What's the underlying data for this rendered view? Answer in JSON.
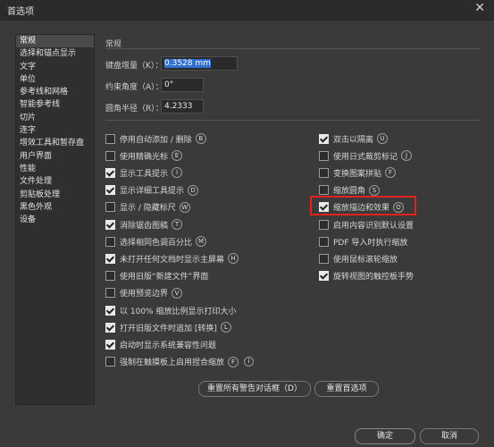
{
  "window": {
    "title": "首选项",
    "close": "✕"
  },
  "sidebar": {
    "items": [
      {
        "label": "常规",
        "selected": true
      },
      {
        "label": "选择和锚点显示"
      },
      {
        "label": "文字"
      },
      {
        "label": "单位"
      },
      {
        "label": "参考线和网格"
      },
      {
        "label": "智能参考线"
      },
      {
        "label": "切片"
      },
      {
        "label": "连字"
      },
      {
        "label": "增效工具和暂存盘"
      },
      {
        "label": "用户界面"
      },
      {
        "label": "性能"
      },
      {
        "label": "文件处理"
      },
      {
        "label": "剪贴板处理"
      },
      {
        "label": "黑色外观"
      },
      {
        "label": "设备"
      }
    ]
  },
  "section_title": "常规",
  "fields": {
    "keyboard_increment": {
      "label": "键盘增量（K）：",
      "value": "0.3528 mm"
    },
    "constrain_angle": {
      "label": "约束角度（A）：",
      "value": "0°"
    },
    "corner_radius": {
      "label": "圆角半径（R）：",
      "value": "4.2333"
    }
  },
  "checkboxes_left": [
    {
      "label": "停用自动添加 / 删除",
      "key": "B",
      "checked": false
    },
    {
      "label": "使用精确光标",
      "key": "E",
      "checked": false
    },
    {
      "label": "显示工具提示",
      "key": "I",
      "checked": true
    },
    {
      "label": "显示详细工具提示",
      "key": "D",
      "checked": true
    },
    {
      "label": "显示 / 隐藏标尺",
      "key": "W",
      "checked": false
    },
    {
      "label": "消除锯齿图稿",
      "key": "T",
      "checked": true
    },
    {
      "label": "选择相同色调百分比",
      "key": "M",
      "checked": false
    },
    {
      "label": "未打开任何文档时显示主屏幕",
      "key": "H",
      "checked": true
    },
    {
      "label": "使用旧版“新建文件”界面",
      "key": "",
      "checked": false
    },
    {
      "label": "使用预览边界",
      "key": "V",
      "checked": false
    },
    {
      "label": "以 100% 缩放比例显示打印大小",
      "key": "",
      "checked": true
    },
    {
      "label": "打开旧版文件时追加 [转换]",
      "key": "L",
      "checked": true
    },
    {
      "label": "启动时显示系统兼容性问题",
      "key": "",
      "checked": true
    },
    {
      "label": "强制在触摸板上启用捏合缩放",
      "key": "F",
      "checked": false,
      "info": "i"
    }
  ],
  "checkboxes_right": [
    {
      "label": "双击以隔离",
      "key": "U",
      "checked": true
    },
    {
      "label": "使用日式裁剪标记",
      "key": "J",
      "checked": false
    },
    {
      "label": "变换图案拼贴",
      "key": "F",
      "checked": false
    },
    {
      "label": "缩放圆角",
      "key": "S",
      "checked": false
    },
    {
      "label": "缩放描边和效果",
      "key": "O",
      "checked": true
    },
    {
      "label": "启用内容识别默认设置",
      "key": "",
      "checked": false
    },
    {
      "label": "PDF 导入时执行缩放",
      "key": "",
      "checked": false
    },
    {
      "label": "使用鼠标滚轮缩放",
      "key": "",
      "checked": false
    },
    {
      "label": "旋转视图的触控板手势",
      "key": "",
      "checked": true
    }
  ],
  "buttons": {
    "reset_warnings": "重置所有警告对话框（D）",
    "reset_prefs": "重置首选项",
    "ok": "确定",
    "cancel": "取消"
  }
}
